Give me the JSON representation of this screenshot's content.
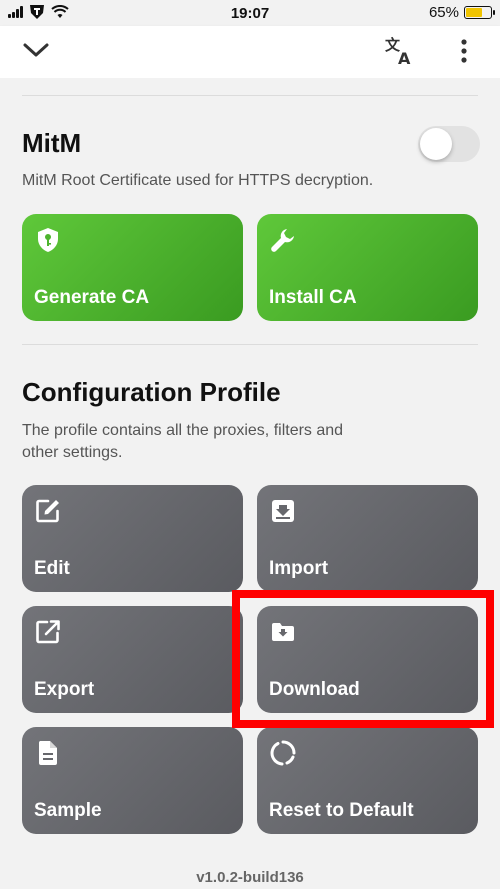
{
  "status_bar": {
    "time": "19:07",
    "battery_percent": "65%",
    "battery_level": 0.65
  },
  "nav": {
    "back_icon": "chevron-down-icon",
    "translate_icon": "translate-icon",
    "more_icon": "more-vertical-icon"
  },
  "mitm": {
    "title": "MitM",
    "description": "MitM Root Certificate used for HTTPS decryption.",
    "enabled": false,
    "buttons": [
      {
        "label": "Generate CA",
        "icon": "shield-key-icon"
      },
      {
        "label": "Install CA",
        "icon": "wrench-icon"
      }
    ]
  },
  "profile": {
    "title": "Configuration Profile",
    "description_line1": "The profile contains all the proxies, filters and",
    "description_line2": "other settings.",
    "buttons": [
      {
        "label": "Edit",
        "icon": "edit-icon"
      },
      {
        "label": "Import",
        "icon": "import-tray-icon"
      },
      {
        "label": "Export",
        "icon": "export-icon"
      },
      {
        "label": "Download",
        "icon": "folder-download-icon"
      },
      {
        "label": "Sample",
        "icon": "document-icon"
      },
      {
        "label": "Reset to Default",
        "icon": "reset-circle-icon"
      }
    ]
  },
  "version": "v1.0.2-build136",
  "colors": {
    "green_tile": "#4db42d",
    "gray_tile": "#66676c",
    "highlight": "#ff0000"
  }
}
